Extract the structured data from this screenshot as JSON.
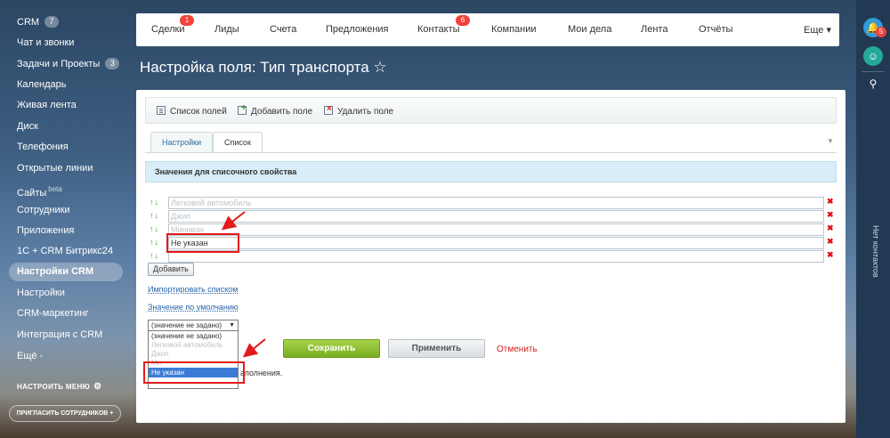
{
  "sidebar": {
    "items": [
      {
        "label": "CRM",
        "badge": "7"
      },
      {
        "label": "Чат и звонки"
      },
      {
        "label": "Задачи и Проекты",
        "badge": "3"
      },
      {
        "label": "Календарь"
      },
      {
        "label": "Живая лента"
      },
      {
        "label": "Диск"
      },
      {
        "label": "Телефония"
      },
      {
        "label": "Открытые линии"
      },
      {
        "label": "Сайты",
        "tag": "beta"
      },
      {
        "label": "Сотрудники"
      },
      {
        "label": "Приложения"
      },
      {
        "label": "1С + CRM Битрикс24"
      },
      {
        "label": "Настройки CRM",
        "active": true
      },
      {
        "label": "Настройки"
      },
      {
        "label": "CRM-маркетинг"
      },
      {
        "label": "Интеграция с CRM"
      },
      {
        "label": "Ещё -"
      }
    ],
    "configure_menu": "НАСТРОИТЬ МЕНЮ",
    "invite": "ПРИГЛАСИТЬ СОТРУДНИКОВ +"
  },
  "rightbar": {
    "notify_count": "5",
    "no_contacts": "Нет контактов"
  },
  "topnav": {
    "items": [
      {
        "label": "Сделки",
        "counter": "1"
      },
      {
        "label": "Лиды"
      },
      {
        "label": "Счета"
      },
      {
        "label": "Предложения"
      },
      {
        "label": "Контакты",
        "counter": "6"
      },
      {
        "label": "Компании"
      },
      {
        "label": "Мои дела"
      },
      {
        "label": "Лента"
      },
      {
        "label": "Отчёты"
      },
      {
        "label": "Еще ▾"
      }
    ]
  },
  "page_title": "Настройка поля: Тип транспорта ☆",
  "toolbar": {
    "field_list": "Список полей",
    "add_field": "Добавить поле",
    "delete_field": "Удалить поле"
  },
  "tabs": {
    "settings": "Настройки",
    "list": "Список"
  },
  "section_title": "Значения для списочного свойства",
  "values": [
    {
      "text": "Легковой автомобиль",
      "blurred": true
    },
    {
      "text": "Джип",
      "blurred": true
    },
    {
      "text": "Минивэн",
      "blurred": true
    },
    {
      "text": "Не указан",
      "blurred": false
    },
    {
      "text": "",
      "blurred": false
    }
  ],
  "add_button": "Добавить",
  "import_link": "Импортировать списком",
  "default_link": "Значение по умолчанию",
  "select": {
    "current": "(значение не задано)",
    "options": [
      {
        "text": "(значение не задано)",
        "blurred": false
      },
      {
        "text": "Легковой автомобиль",
        "blurred": true
      },
      {
        "text": "Джип",
        "blurred": true
      },
      {
        "text": "Ми",
        "blurred": true
      },
      {
        "text": "Не указан",
        "selected": true
      }
    ]
  },
  "hint_tail": "аполнения.",
  "buttons": {
    "save": "Сохранить",
    "apply": "Применить",
    "cancel": "Отменить"
  },
  "colors": {
    "accent_save": "#79ad22",
    "annotation_red": "#e31b1b",
    "link_blue": "#2a66a7",
    "section_header_bg": "#d8edf7"
  }
}
